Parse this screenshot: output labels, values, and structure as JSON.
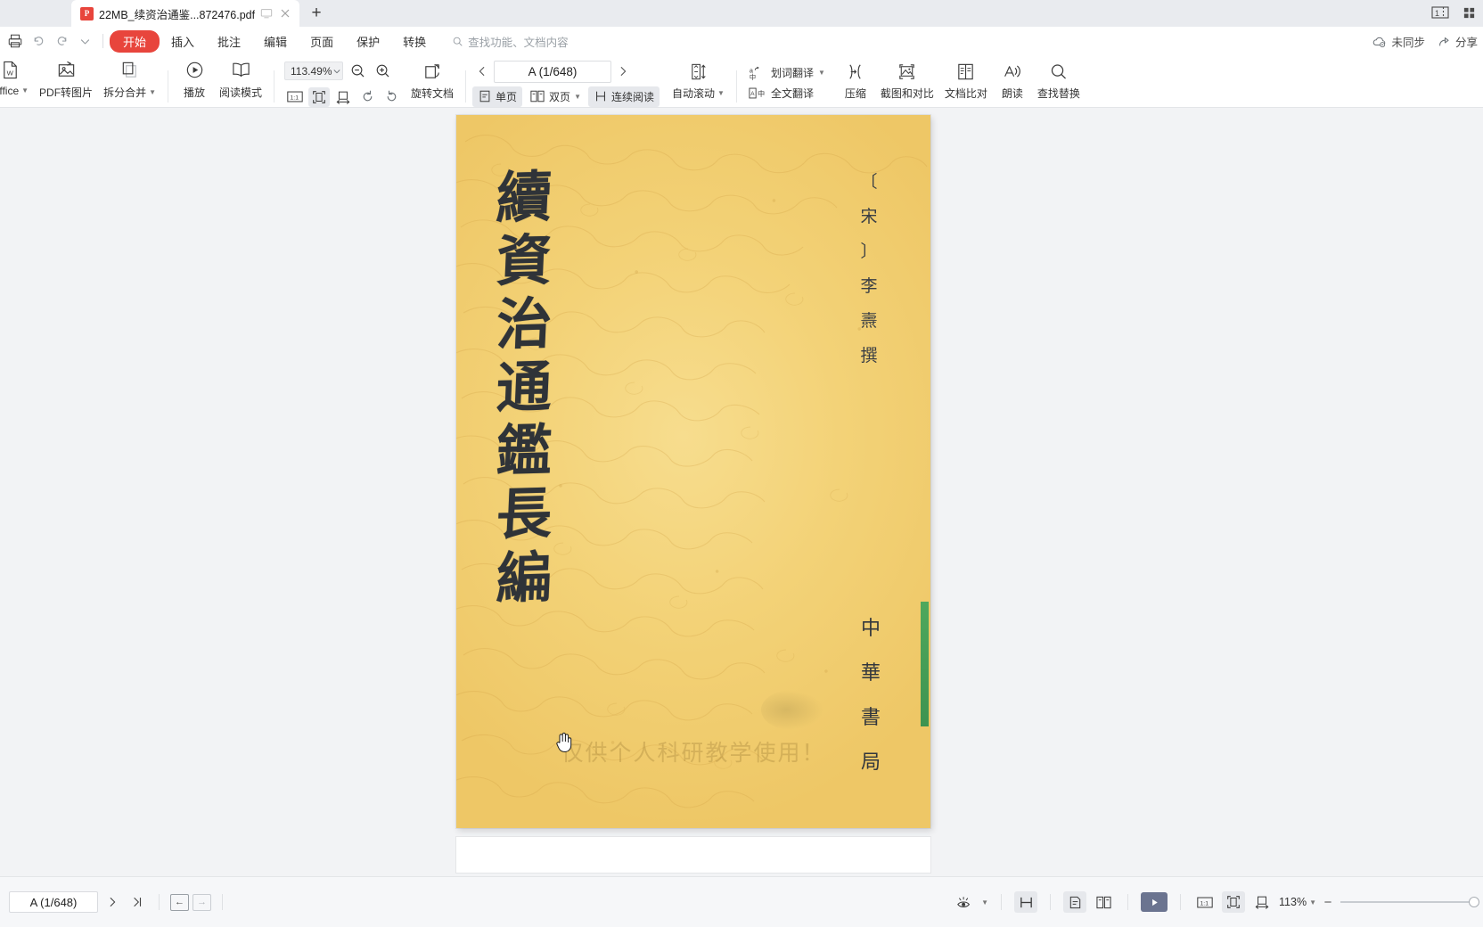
{
  "window": {
    "tab": {
      "title": "22MB_续资治通鉴...872476.pdf",
      "badge": "P"
    },
    "new_tab_label": "+",
    "controls": {
      "layout": "window-layout",
      "grid": "grid-view"
    }
  },
  "menubar": {
    "items": [
      {
        "label": "开始",
        "active": true
      },
      {
        "label": "插入",
        "active": false
      },
      {
        "label": "批注",
        "active": false
      },
      {
        "label": "编辑",
        "active": false
      },
      {
        "label": "页面",
        "active": false
      },
      {
        "label": "保护",
        "active": false
      },
      {
        "label": "转换",
        "active": false
      }
    ],
    "search_placeholder": "查找功能、文档内容",
    "right": [
      {
        "label": "未同步",
        "icon": "cloud-offline-icon"
      },
      {
        "label": "分享",
        "icon": "share-icon"
      }
    ]
  },
  "ribbon": {
    "office_label": "Office",
    "pdf_to_image_label": "PDF转图片",
    "split_merge_label": "拆分合并",
    "play_label": "播放",
    "read_mode_label": "阅读模式",
    "zoom_value": "113.49%",
    "rotate_label": "旋转文档",
    "page_value": "A (1/648)",
    "single_page_label": "单页",
    "double_page_label": "双页",
    "continuous_label": "连续阅读",
    "autoscroll_label": "自动滚动",
    "word_translate_label": "划词翻译",
    "full_translate_label": "全文翻译",
    "compress_label": "压缩",
    "screenshot_compare_label": "截图和对比",
    "doc_compare_label": "文档比对",
    "read_aloud_label": "朗读",
    "find_replace_label": "查找替换",
    "selected_tools": [
      "fit-page",
      "single-page",
      "continuous-read"
    ]
  },
  "document": {
    "title_chars": [
      "續",
      "資",
      "治",
      "通",
      "鑑",
      "長",
      "編"
    ],
    "author_chars": [
      "〔",
      "宋",
      "〕",
      "李",
      "燾",
      "撰"
    ],
    "publisher_chars": [
      "中",
      "華",
      "書",
      "局"
    ],
    "watermark": "仅供个人科研教学使用！",
    "cursor": "hand-cursor"
  },
  "statusbar": {
    "page_value": "A (1/648)",
    "next_page": "next-page",
    "last_page": "last-page",
    "back_label": "←",
    "forward_label": "→",
    "eye_icon": "eye-protection-icon",
    "fit_width_icon": "fit-width-icon",
    "single_icon": "single-page-view-icon",
    "double_icon": "double-page-view-icon",
    "play_icon": "slideshow-icon",
    "actual_size_label": "1:1",
    "fit_page_icon": "fit-page-icon",
    "fit_width2_icon": "fit-width-icon",
    "zoom_label": "113%",
    "minus": "−",
    "plus": "+"
  },
  "colors": {
    "accent": "#e8453c",
    "page_bg": "#f2d277",
    "ink": "#2f3338",
    "green_mark": "#4fa85c",
    "play_bg": "#6b7490"
  }
}
